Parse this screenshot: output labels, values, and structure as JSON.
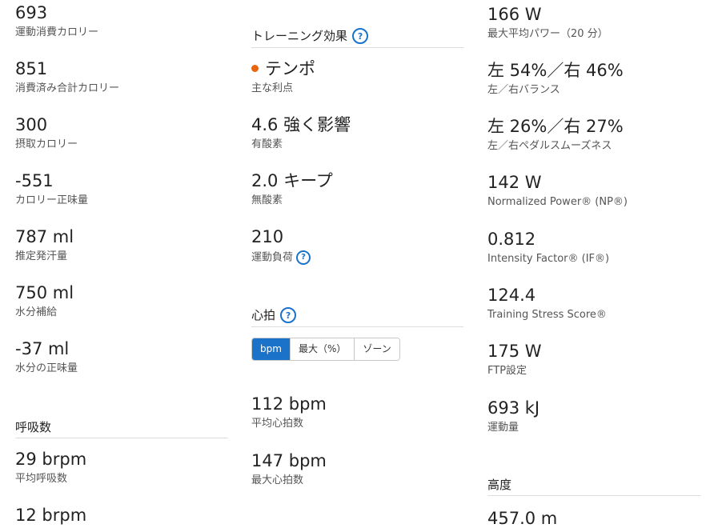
{
  "accent": "#1a73c9",
  "tempo_dot_color": "#e8650f",
  "help_icon_glyph": "?",
  "column1": {
    "stats": [
      {
        "value": "693",
        "label": "運動消費カロリー"
      },
      {
        "value": "851",
        "label": "消費済み合計カロリー"
      },
      {
        "value": "300",
        "label": "摂取カロリー"
      },
      {
        "value": "-551",
        "label": "カロリー正味量"
      },
      {
        "value": "787 ml",
        "label": "推定発汗量"
      },
      {
        "value": "750 ml",
        "label": "水分補給"
      },
      {
        "value": "-37 ml",
        "label": "水分の正味量"
      }
    ],
    "respiration": {
      "title": "呼吸数",
      "stats": [
        {
          "value": "29 brpm",
          "label": "平均呼吸数"
        },
        {
          "value": "12 brpm",
          "label": ""
        }
      ]
    }
  },
  "column2": {
    "training_effect": {
      "title": "トレーニング効果",
      "stats": [
        {
          "value": "テンポ",
          "label": "主な利点"
        },
        {
          "value": "4.6 強く影響",
          "label": "有酸素"
        },
        {
          "value": "2.0 キープ",
          "label": "無酸素"
        },
        {
          "value": "210",
          "label": "運動負荷"
        }
      ]
    },
    "heart_rate": {
      "title": "心拍",
      "toggle": [
        "bpm",
        "最大（%）",
        "ゾーン"
      ],
      "toggle_selected": "bpm",
      "stats": [
        {
          "value": "112 bpm",
          "label": "平均心拍数"
        },
        {
          "value": "147 bpm",
          "label": "最大心拍数"
        }
      ]
    }
  },
  "column3": {
    "stats": [
      {
        "value": "166 W",
        "label": "最大平均パワー（20 分）"
      },
      {
        "value": "左 54%／右 46%",
        "label": "左／右バランス"
      },
      {
        "value": "左 26%／右 27%",
        "label": "左／右ペダルスムーズネス"
      },
      {
        "value": "142 W",
        "label": "Normalized Power® (NP®)"
      },
      {
        "value": "0.812",
        "label": "Intensity Factor® (IF®)"
      },
      {
        "value": "124.4",
        "label": "Training Stress Score®"
      },
      {
        "value": "175 W",
        "label": "FTP設定"
      },
      {
        "value": "693 kJ",
        "label": "運動量"
      }
    ],
    "elevation": {
      "title": "高度",
      "stats": [
        {
          "value": "457.0 m",
          "label": ""
        }
      ]
    }
  }
}
